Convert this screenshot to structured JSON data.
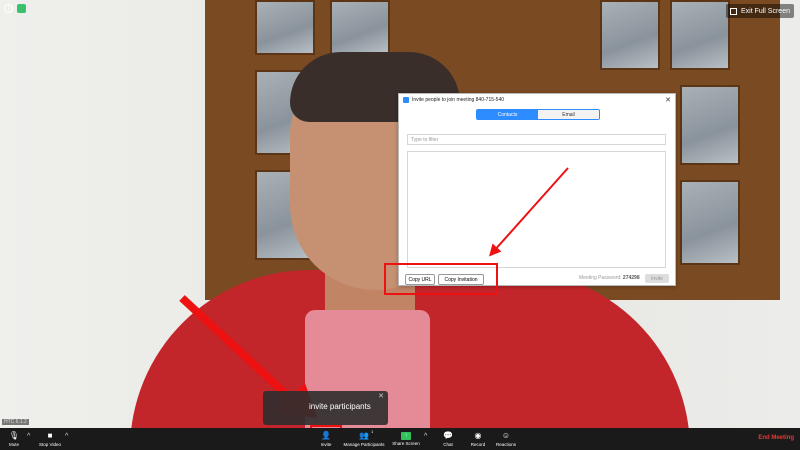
{
  "window": {
    "exit_fullscreen_label": "Exit Full Screen"
  },
  "invite_dialog": {
    "title": "Invite people to join meeting 840-715-540",
    "tabs": [
      {
        "label": "Contacts",
        "active": true
      },
      {
        "label": "Email",
        "active": false
      }
    ],
    "filter_placeholder": "Type to filter",
    "copy_url_label": "Copy URL",
    "copy_invitation_label": "Copy Invitation",
    "password_label": "Meeting Password:",
    "password_value": "274298",
    "invite_button_label": "Invite",
    "close_symbol": "✕"
  },
  "toast": {
    "text": "invite participants",
    "close_symbol": "✕"
  },
  "video_label": "HTC 6.1.2",
  "toolbar": {
    "mute_label": "Mute",
    "stop_video_label": "Stop Video",
    "invite_label": "Invite",
    "participants_label": "Manage Participants",
    "participants_count": "1",
    "share_label": "Share Screen",
    "chat_label": "Chat",
    "record_label": "Record",
    "reactions_label": "Reactions",
    "end_label": "End Meeting"
  },
  "colors": {
    "accent": "#2d8cff",
    "highlight": "#e11111",
    "share": "#30c15a",
    "end": "#e53935",
    "toolbar": "#1a1a1a"
  }
}
